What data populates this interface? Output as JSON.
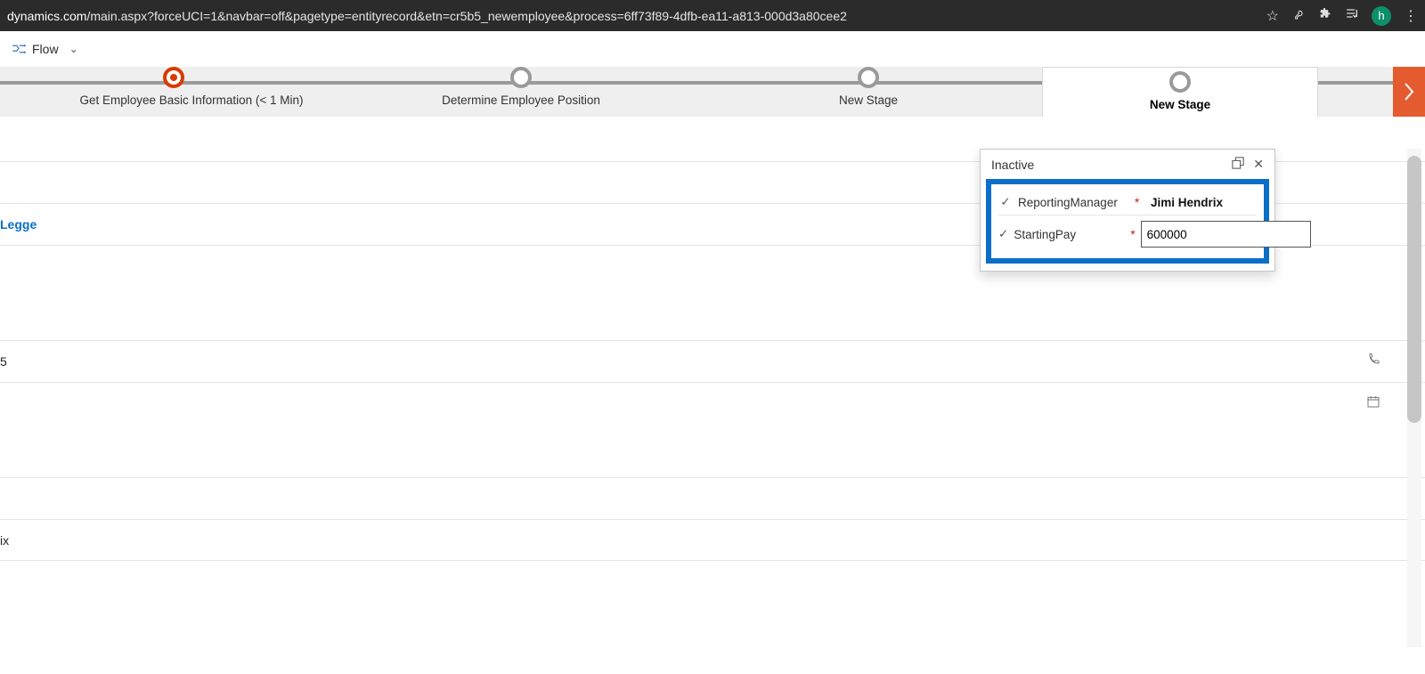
{
  "browser": {
    "url_domain": "dynamics.com",
    "url_path": "/main.aspx?forceUCI=1&navbar=off&pagetype=entityrecord&etn=cr5b5_newemployee&process=6ff73f89-4dfb-ea11-a813-000d3a80cee2",
    "avatar_letter": "h"
  },
  "commandbar": {
    "flow_label": "Flow"
  },
  "process": {
    "stages": [
      {
        "label": "Get Employee Basic Information  (< 1 Min)",
        "state": "current"
      },
      {
        "label": "Determine Employee Position",
        "state": "pending"
      },
      {
        "label": "New Stage",
        "state": "pending"
      },
      {
        "label": "New Stage",
        "state": "active-selected"
      }
    ]
  },
  "flyout": {
    "title": "Inactive",
    "fields": [
      {
        "label": "ReportingManager",
        "required": true,
        "value": "Jimi Hendrix",
        "type": "lookup"
      },
      {
        "label": "StartingPay",
        "required": true,
        "value": "600000",
        "type": "text"
      }
    ]
  },
  "form_rows": {
    "link_text": "Legge",
    "row4_trail": "5",
    "row7_trail": "ix"
  }
}
